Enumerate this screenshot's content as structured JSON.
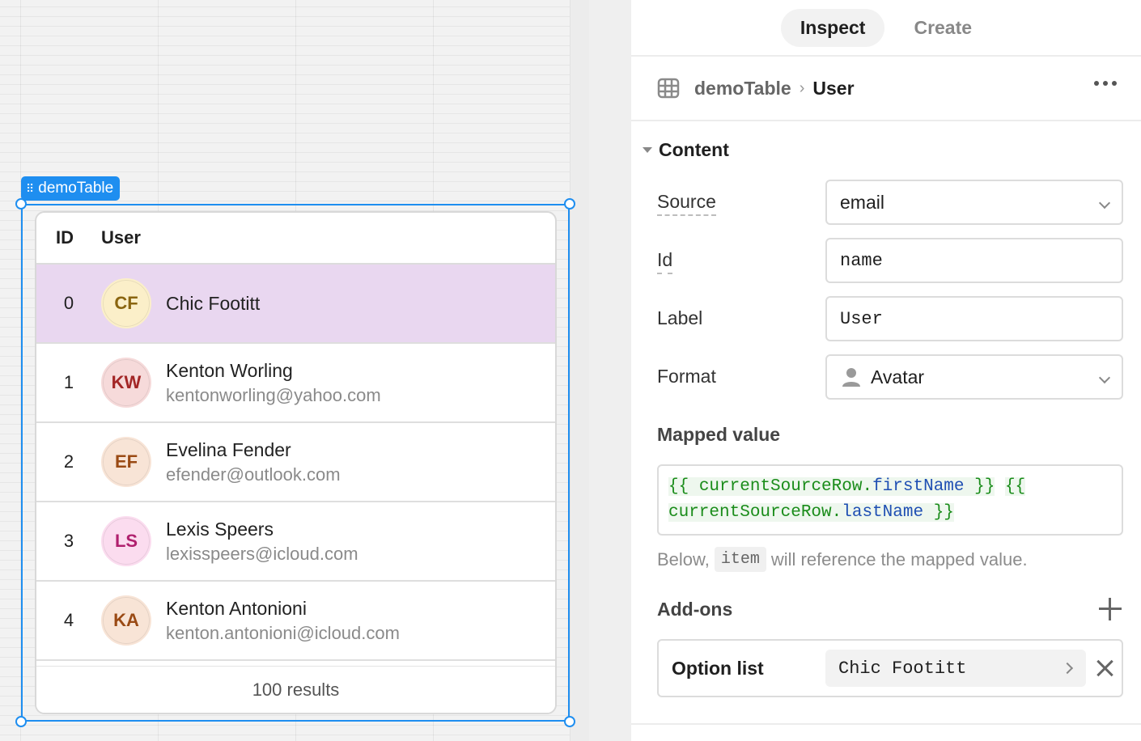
{
  "canvas": {
    "selection_tag": "demoTable",
    "table": {
      "columns": [
        "ID",
        "User"
      ],
      "rows": [
        {
          "id": "0",
          "initials": "CF",
          "name": "Chic Footitt",
          "email": "",
          "avatar_bg": "#fbefc9",
          "avatar_fg": "#8a6510",
          "selected": true
        },
        {
          "id": "1",
          "initials": "KW",
          "name": "Kenton Worling",
          "email": "kentonworling@yahoo.com",
          "avatar_bg": "#f6dada",
          "avatar_fg": "#a32626"
        },
        {
          "id": "2",
          "initials": "EF",
          "name": "Evelina Fender",
          "email": "efender@outlook.com",
          "avatar_bg": "#f8e4d6",
          "avatar_fg": "#9a4a14"
        },
        {
          "id": "3",
          "initials": "LS",
          "name": "Lexis Speers",
          "email": "lexisspeers@icloud.com",
          "avatar_bg": "#fbdcef",
          "avatar_fg": "#b0206e"
        },
        {
          "id": "4",
          "initials": "KA",
          "name": "Kenton Antonioni",
          "email": "kenton.antonioni@icloud.com",
          "avatar_bg": "#f8e4d6",
          "avatar_fg": "#9a4a14"
        }
      ],
      "footer": "100 results"
    }
  },
  "inspector": {
    "tabs": [
      "Inspect",
      "Create"
    ],
    "active_tab": "Inspect",
    "breadcrumb": {
      "parent": "demoTable",
      "separator": "›",
      "current": "User"
    },
    "section_title": "Content",
    "properties": {
      "source": {
        "label": "Source",
        "value": "email"
      },
      "id": {
        "label": "Id",
        "value": "name"
      },
      "label": {
        "label": "Label",
        "value": "User"
      },
      "format": {
        "label": "Format",
        "value": "Avatar"
      }
    },
    "mapped_value": {
      "label": "Mapped value",
      "open1": "{{",
      "obj1": "currentSourceRow",
      "dot1": ".",
      "prop1": "firstName",
      "close1": "}}",
      "open2": "{{",
      "obj2": "currentSourceRow",
      "dot2": ".",
      "prop2": "lastName",
      "close2": "}}"
    },
    "hint": {
      "before": "Below,",
      "code": "item",
      "after": "will reference the mapped value."
    },
    "addons": {
      "label": "Add-ons",
      "items": [
        {
          "label": "Option list",
          "value": "Chic Footitt"
        }
      ]
    }
  },
  "colors": {
    "accent": "#1e8ef0",
    "selected_row": "#e9d7f0"
  }
}
